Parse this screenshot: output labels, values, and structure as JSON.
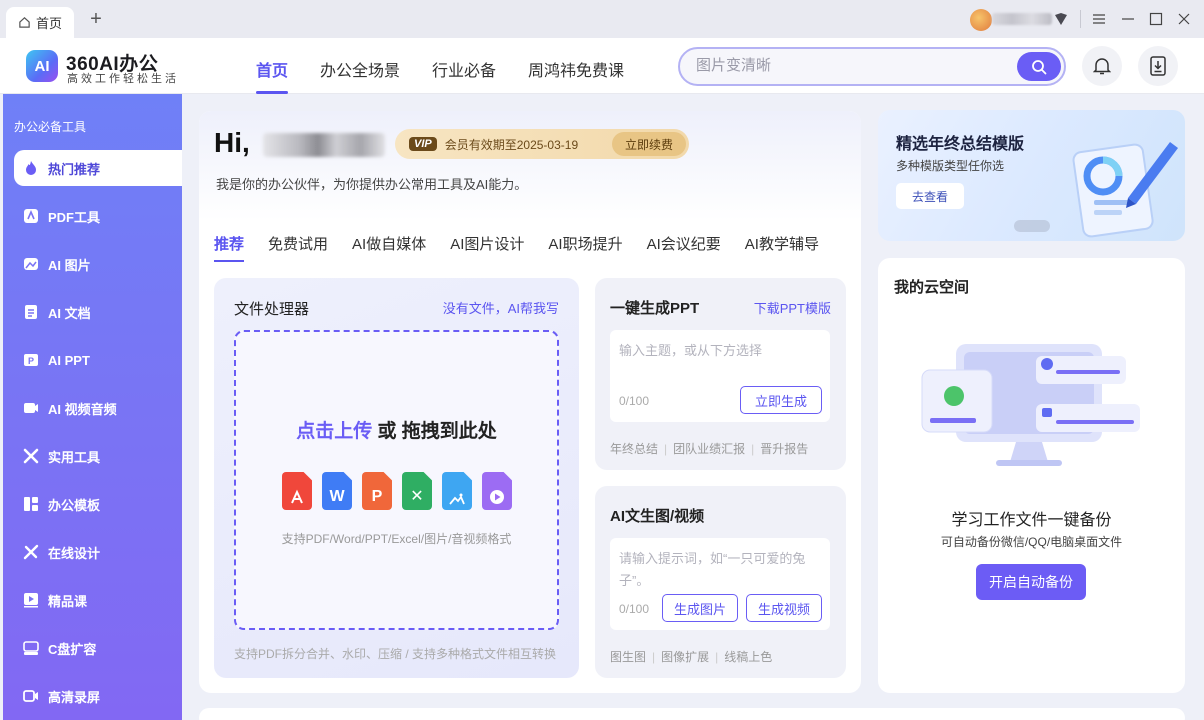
{
  "titlebar": {
    "tab_label": "首页",
    "new_tab": "+"
  },
  "header": {
    "logo_badge": "AI",
    "logo_title": "360AI办公",
    "logo_subtitle": "高效工作轻松生活",
    "nav": [
      "首页",
      "办公全场景",
      "行业必备",
      "周鸿祎免费课"
    ],
    "search_placeholder": "图片变清晰"
  },
  "sidebar": {
    "heading": "办公必备工具",
    "items": [
      {
        "label": "热门推荐",
        "icon": "flame-icon"
      },
      {
        "label": "PDF工具",
        "icon": "pdf-icon"
      },
      {
        "label": "AI 图片",
        "icon": "image-icon"
      },
      {
        "label": "AI 文档",
        "icon": "document-icon"
      },
      {
        "label": "AI PPT",
        "icon": "ppt-icon"
      },
      {
        "label": "AI 视频音频",
        "icon": "video-icon"
      },
      {
        "label": "实用工具",
        "icon": "tools-icon"
      },
      {
        "label": "办公模板",
        "icon": "template-icon"
      },
      {
        "label": "在线设计",
        "icon": "design-icon"
      },
      {
        "label": "精品课",
        "icon": "course-icon"
      },
      {
        "label": "C盘扩容",
        "icon": "disk-icon"
      },
      {
        "label": "高清录屏",
        "icon": "record-icon"
      }
    ]
  },
  "main": {
    "greeting": "Hi,",
    "vip_badge": "VIP",
    "vip_text": "会员有效期至2025-03-19",
    "renew_label": "立即续费",
    "subtitle": "我是你的办公伙伴，为你提供办公常用工具及AI能力。",
    "tabs": [
      "推荐",
      "免费试用",
      "AI做自媒体",
      "AI图片设计",
      "AI职场提升",
      "AI会议纪要",
      "AI教学辅导"
    ],
    "file_processor": {
      "title": "文件处理器",
      "link": "没有文件，AI帮我写",
      "upload_highlight": "点击上传",
      "upload_rest": " 或 拖拽到此处",
      "formats": "支持PDF/Word/PPT/Excel/图片/音视频格式",
      "footer": "支持PDF拆分合并、水印、压缩 / 支持多种格式文件相互转换"
    },
    "ppt": {
      "title": "一键生成PPT",
      "link": "下载PPT模版",
      "placeholder": "输入主题，或从下方选择",
      "count": "0/100",
      "button": "立即生成",
      "tags": [
        "年终总结",
        "团队业绩汇报",
        "晋升报告"
      ]
    },
    "ai_media": {
      "title": "AI文生图/视频",
      "placeholder": "请输入提示词，如“一只可爱的兔子”。",
      "count": "0/100",
      "button_image": "生成图片",
      "button_video": "生成视频",
      "tags": [
        "图生图",
        "图像扩展",
        "线稿上色"
      ]
    }
  },
  "banner": {
    "title": "精选年终总结模版",
    "subtitle": "多种模版类型任你选",
    "button": "去查看"
  },
  "cloud": {
    "title": "我的云空间",
    "headline": "学习工作文件一键备份",
    "description": "可自动备份微信/QQ/电脑桌面文件",
    "button": "开启自动备份"
  },
  "colors": {
    "accent": "#5b55f0",
    "sidebar_top": "#6f80f7",
    "sidebar_bottom": "#8268f3",
    "vip_gold": "#f2d9ab"
  }
}
